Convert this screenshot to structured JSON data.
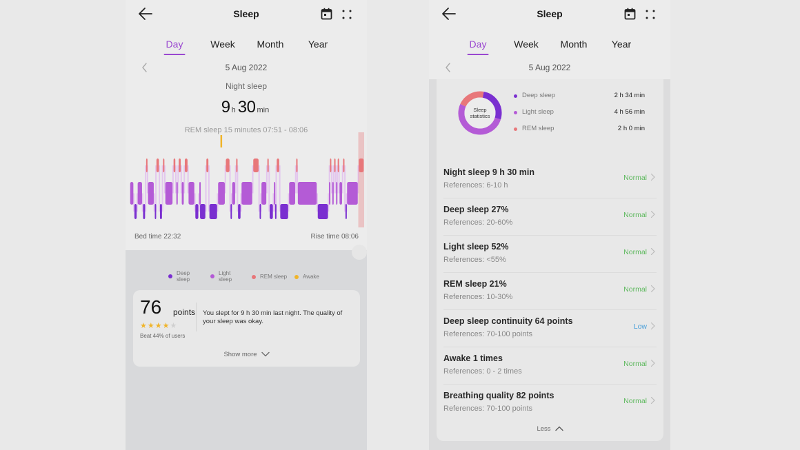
{
  "colors": {
    "accent": "#9a48d0",
    "deep": "#7a2fd0",
    "light": "#b45bd6",
    "rem": "#e8777a",
    "awake": "#f0b429",
    "status_normal": "#5cb85c",
    "status_low": "#4a9fd8"
  },
  "left": {
    "header": {
      "title": "Sleep",
      "back_icon": "arrow-left-icon",
      "calendar_icon": "calendar-icon",
      "more_icon": "grid-dots-icon"
    },
    "tabs": [
      {
        "label": "Day",
        "active": true
      },
      {
        "label": "Week",
        "active": false
      },
      {
        "label": "Month",
        "active": false
      },
      {
        "label": "Year",
        "active": false
      }
    ],
    "date": "5 Aug 2022",
    "night_sleep_label": "Night sleep",
    "duration": {
      "hours": "9",
      "hours_unit": "h",
      "minutes": "30",
      "minutes_unit": "min"
    },
    "rem_note": "REM sleep 15 minutes 07:51 - 08:06",
    "bed_time": "Bed time 22:32",
    "rise_time": "Rise time 08:06",
    "legend": [
      {
        "label": "Deep sleep",
        "color": "#7a2fd0"
      },
      {
        "label": "Light sleep",
        "color": "#b45bd6"
      },
      {
        "label": "REM sleep",
        "color": "#e8777a"
      },
      {
        "label": "Awake",
        "color": "#f0b429"
      }
    ],
    "score": {
      "value": "76",
      "unit": "points",
      "stars": 4,
      "max_stars": 5,
      "beat": "Beat 44% of users",
      "summary": "You slept for 9 h 30 min last night. The quality of your sleep was okay.",
      "show_more": "Show more"
    }
  },
  "chart_data": {
    "type": "hypnogram",
    "title": "Night sleep",
    "x_start": "22:32",
    "x_end": "08:06",
    "levels": [
      "REM",
      "Light",
      "Deep"
    ],
    "awake_marker_fraction": 0.39,
    "segments": [
      {
        "s": "light",
        "a": 0.0,
        "b": 0.018
      },
      {
        "s": "deep",
        "a": 0.018,
        "b": 0.032
      },
      {
        "s": "light",
        "a": 0.032,
        "b": 0.055
      },
      {
        "s": "deep",
        "a": 0.055,
        "b": 0.068
      },
      {
        "s": "rem",
        "a": 0.068,
        "b": 0.076
      },
      {
        "s": "light",
        "a": 0.076,
        "b": 0.105
      },
      {
        "s": "deep",
        "a": 0.105,
        "b": 0.112
      },
      {
        "s": "rem",
        "a": 0.112,
        "b": 0.127
      },
      {
        "s": "deep",
        "a": 0.127,
        "b": 0.14
      },
      {
        "s": "rem",
        "a": 0.14,
        "b": 0.15
      },
      {
        "s": "light",
        "a": 0.15,
        "b": 0.185
      },
      {
        "s": "rem",
        "a": 0.185,
        "b": 0.197
      },
      {
        "s": "light",
        "a": 0.197,
        "b": 0.207
      },
      {
        "s": "rem",
        "a": 0.207,
        "b": 0.22
      },
      {
        "s": "light",
        "a": 0.22,
        "b": 0.233
      },
      {
        "s": "rem",
        "a": 0.233,
        "b": 0.249
      },
      {
        "s": "light",
        "a": 0.249,
        "b": 0.278
      },
      {
        "s": "deep",
        "a": 0.278,
        "b": 0.295
      },
      {
        "s": "light",
        "a": 0.295,
        "b": 0.298
      },
      {
        "s": "deep",
        "a": 0.298,
        "b": 0.325
      },
      {
        "s": "rem",
        "a": 0.325,
        "b": 0.338
      },
      {
        "s": "deep",
        "a": 0.338,
        "b": 0.375
      },
      {
        "s": "light",
        "a": 0.375,
        "b": 0.408
      },
      {
        "s": "rem",
        "a": 0.408,
        "b": 0.428
      },
      {
        "s": "deep",
        "a": 0.428,
        "b": 0.435
      },
      {
        "s": "light",
        "a": 0.435,
        "b": 0.452
      },
      {
        "s": "rem",
        "a": 0.452,
        "b": 0.46
      },
      {
        "s": "deep",
        "a": 0.46,
        "b": 0.475
      },
      {
        "s": "light",
        "a": 0.475,
        "b": 0.525
      },
      {
        "s": "rem",
        "a": 0.525,
        "b": 0.552
      },
      {
        "s": "deep",
        "a": 0.552,
        "b": 0.56
      },
      {
        "s": "light",
        "a": 0.56,
        "b": 0.585
      },
      {
        "s": "rem",
        "a": 0.585,
        "b": 0.595
      },
      {
        "s": "deep",
        "a": 0.595,
        "b": 0.613
      },
      {
        "s": "light",
        "a": 0.613,
        "b": 0.618
      },
      {
        "s": "deep",
        "a": 0.618,
        "b": 0.625
      },
      {
        "s": "rem",
        "a": 0.625,
        "b": 0.64
      },
      {
        "s": "deep",
        "a": 0.64,
        "b": 0.678
      },
      {
        "s": "light",
        "a": 0.678,
        "b": 0.708
      },
      {
        "s": "rem",
        "a": 0.708,
        "b": 0.715
      },
      {
        "s": "light",
        "a": 0.715,
        "b": 0.8
      },
      {
        "s": "deep",
        "a": 0.8,
        "b": 0.848
      },
      {
        "s": "light",
        "a": 0.848,
        "b": 0.852
      },
      {
        "s": "rem",
        "a": 0.852,
        "b": 0.862
      },
      {
        "s": "light",
        "a": 0.862,
        "b": 0.87
      },
      {
        "s": "rem",
        "a": 0.87,
        "b": 0.878
      },
      {
        "s": "light",
        "a": 0.878,
        "b": 0.885
      },
      {
        "s": "rem",
        "a": 0.885,
        "b": 0.893
      },
      {
        "s": "light",
        "a": 0.893,
        "b": 0.908
      },
      {
        "s": "rem",
        "a": 0.908,
        "b": 0.918
      },
      {
        "s": "deep",
        "a": 0.918,
        "b": 0.925
      },
      {
        "s": "light",
        "a": 0.925,
        "b": 0.975
      },
      {
        "s": "rem",
        "a": 0.975,
        "b": 1.0
      }
    ]
  },
  "right": {
    "header": {
      "title": "Sleep",
      "back_icon": "arrow-left-icon",
      "calendar_icon": "calendar-icon",
      "more_icon": "grid-dots-icon"
    },
    "tabs": [
      {
        "label": "Day",
        "active": true
      },
      {
        "label": "Week",
        "active": false
      },
      {
        "label": "Month",
        "active": false
      },
      {
        "label": "Year",
        "active": false
      }
    ],
    "date": "5 Aug 2022",
    "donut_label": "Sleep statistics",
    "stats": [
      {
        "name": "Deep sleep",
        "value": "2 h 34 min",
        "minutes": 154,
        "color": "#7a2fd0"
      },
      {
        "name": "Light sleep",
        "value": "4 h 56 min",
        "minutes": 296,
        "color": "#b45bd6"
      },
      {
        "name": "REM sleep",
        "value": "2 h 0 min",
        "minutes": 120,
        "color": "#e8777a"
      }
    ],
    "metrics": [
      {
        "title": "Night sleep 9 h 30 min",
        "ref": "References: 6-10 h",
        "status": "Normal",
        "status_color": "#5cb85c"
      },
      {
        "title": "Deep sleep 27%",
        "ref": "References: 20-60%",
        "status": "Normal",
        "status_color": "#5cb85c"
      },
      {
        "title": "Light sleep 52%",
        "ref": "References: <55%",
        "status": "Normal",
        "status_color": "#5cb85c"
      },
      {
        "title": "REM sleep 21%",
        "ref": "References: 10-30%",
        "status": "Normal",
        "status_color": "#5cb85c"
      },
      {
        "title": "Deep sleep continuity 64 points",
        "ref": "References: 70-100 points",
        "status": "Low",
        "status_color": "#4a9fd8"
      },
      {
        "title": "Awake 1 times",
        "ref": "References: 0 - 2 times",
        "status": "Normal",
        "status_color": "#5cb85c"
      },
      {
        "title": "Breathing quality 82 points",
        "ref": "References: 70-100 points",
        "status": "Normal",
        "status_color": "#5cb85c"
      }
    ],
    "less_label": "Less"
  }
}
